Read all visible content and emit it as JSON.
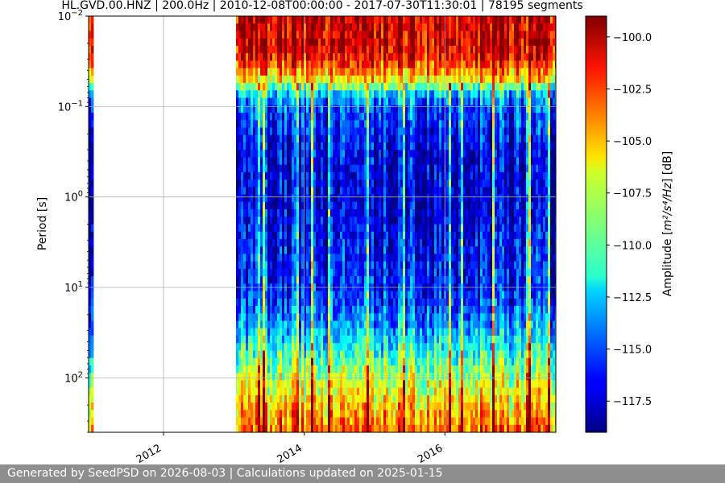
{
  "chart_data": {
    "type": "heatmap",
    "title": "HL.GVD.00.HNZ | 200.0Hz | 2010-12-08T00:00:00 - 2017-07-30T11:30:01 | 78195 segments",
    "ylabel": "Period [s]",
    "colorbar_label_pre": "Amplitude [",
    "colorbar_label_unit": "m²/s⁴/Hz",
    "colorbar_label_post": "] [dB]",
    "colormap": "jet",
    "x_range": [
      "2010-12-08",
      "2017-07-30"
    ],
    "x_ticks": [
      "2012",
      "2014",
      "2016"
    ],
    "y_scale": "log",
    "y_range": [
      0.01,
      400
    ],
    "y_inverted": true,
    "y_ticks": [
      {
        "value": 0.01,
        "base": "10",
        "exp": "−2"
      },
      {
        "value": 0.1,
        "base": "10",
        "exp": "−1"
      },
      {
        "value": 1,
        "base": "10",
        "exp": "0"
      },
      {
        "value": 10,
        "base": "10",
        "exp": "1"
      },
      {
        "value": 100,
        "base": "10",
        "exp": "2"
      }
    ],
    "color_range": [
      -119,
      -99
    ],
    "colorbar_ticks": [
      "−100.0",
      "−102.5",
      "−105.0",
      "−107.5",
      "−110.0",
      "−112.5",
      "−115.0",
      "−117.5"
    ],
    "colorbar_tick_values": [
      -100.0,
      -102.5,
      -105.0,
      -107.5,
      -110.0,
      -112.5,
      -115.0,
      -117.5
    ],
    "data_gaps": [
      [
        "2011-01-10",
        "2012-12-31"
      ]
    ],
    "amplitude_profile_db": [
      {
        "period_s": 0.01,
        "db": -100.5
      },
      {
        "period_s": 0.02,
        "db": -100.5
      },
      {
        "period_s": 0.03,
        "db": -101.5
      },
      {
        "period_s": 0.05,
        "db": -106
      },
      {
        "period_s": 0.07,
        "db": -112
      },
      {
        "period_s": 0.1,
        "db": -115
      },
      {
        "period_s": 0.3,
        "db": -117
      },
      {
        "period_s": 1,
        "db": -117.5
      },
      {
        "period_s": 3,
        "db": -116.5
      },
      {
        "period_s": 10,
        "db": -116
      },
      {
        "period_s": 20,
        "db": -114.5
      },
      {
        "period_s": 50,
        "db": -111
      },
      {
        "period_s": 100,
        "db": -108
      },
      {
        "period_s": 200,
        "db": -105.5
      },
      {
        "period_s": 400,
        "db": -103.5
      }
    ],
    "grid": true
  },
  "footer": {
    "text": "Generated by SeedPSD on 2026-08-03 | Calculations updated on 2025-01-15"
  }
}
